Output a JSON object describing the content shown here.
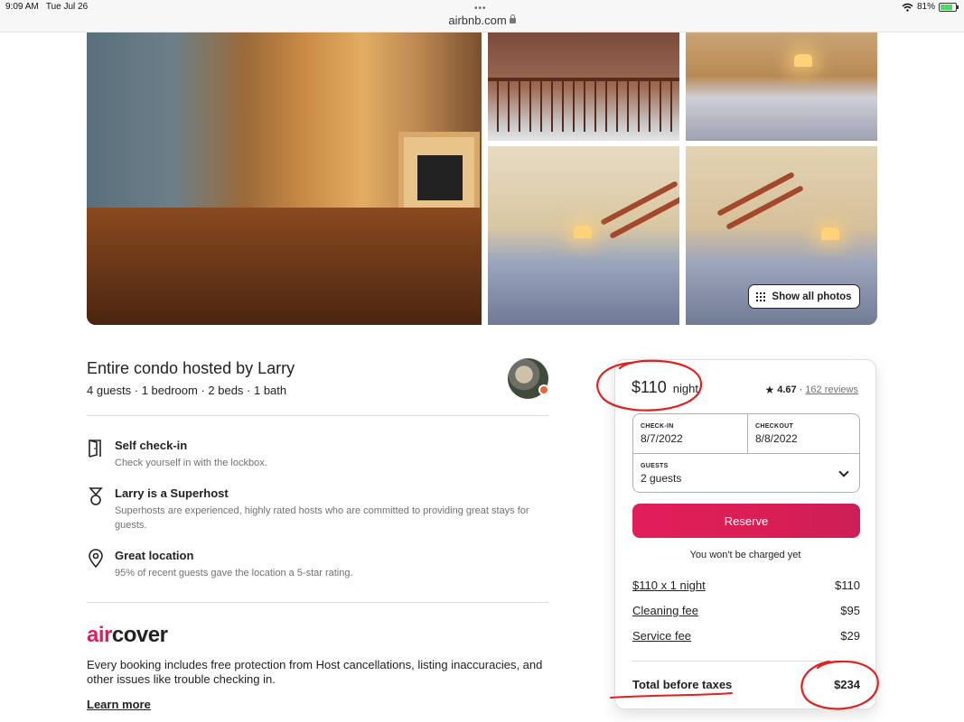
{
  "status_bar": {
    "time": "9:09 AM",
    "date": "Tue Jul 26",
    "battery": "81%",
    "battery_level": 0.81,
    "icons": [
      "wifi-icon",
      "battery-icon"
    ]
  },
  "browser": {
    "url": "airbnb.com",
    "icons": [
      "lock-icon"
    ]
  },
  "photos": {
    "show_all_label": "Show all photos"
  },
  "listing": {
    "title": "Entire condo hosted by Larry",
    "subtitle": "4 guests · 1 bedroom · 2 beds · 1 bath",
    "features": [
      {
        "icon": "door-icon",
        "title": "Self check-in",
        "description": "Check yourself in with the lockbox."
      },
      {
        "icon": "medal-icon",
        "title": "Larry is a Superhost",
        "description": "Superhosts are experienced, highly rated hosts who are committed to providing great stays for guests."
      },
      {
        "icon": "location-pin-icon",
        "title": "Great location",
        "description": "95% of recent guests gave the location a 5-star rating."
      }
    ]
  },
  "aircover": {
    "logo_prefix": "air",
    "logo_suffix": "cover",
    "description": "Every booking includes free protection from Host cancellations, listing inaccuracies, and other issues like trouble checking in.",
    "learn_more": "Learn more"
  },
  "booking": {
    "price": "$110",
    "per": "night",
    "rating": "4.67",
    "separator": "·",
    "reviews": "162 reviews",
    "checkin_label": "CHECK-IN",
    "checkin_value": "8/7/2022",
    "checkout_label": "CHECKOUT",
    "checkout_value": "8/8/2022",
    "guests_label": "GUESTS",
    "guests_value": "2 guests",
    "reserve_label": "Reserve",
    "no_charge": "You won't be charged yet",
    "line_items": [
      {
        "label": "$110 x 1 night",
        "amount": "$110"
      },
      {
        "label": "Cleaning fee",
        "amount": "$95"
      },
      {
        "label": "Service fee",
        "amount": "$29"
      }
    ],
    "total_label": "Total before taxes",
    "total_amount": "$234"
  },
  "colors": {
    "brand": "#e31c5f",
    "reserve": "#dd1e56",
    "annotation": "#e0211f"
  }
}
